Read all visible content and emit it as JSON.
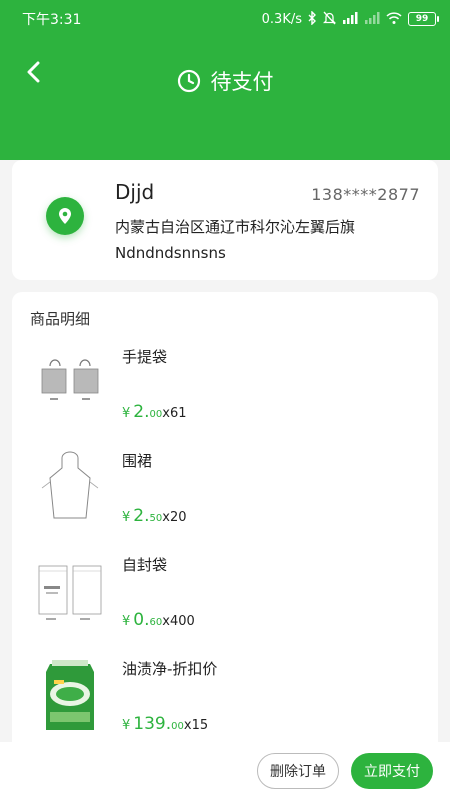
{
  "status_bar": {
    "time": "下午3:31",
    "speed": "0.3K/s",
    "battery": "99"
  },
  "header": {
    "title": "待支付"
  },
  "address": {
    "name": "Djjd",
    "phone": "138****2877",
    "line1": "内蒙古自治区通辽市科尔沁左翼后旗",
    "line2": "Ndndndsnnsns"
  },
  "goods": {
    "section_title": "商品明细",
    "items": [
      {
        "name": "手提袋",
        "currency": "¥",
        "price_int": "2.",
        "price_dec": "00",
        "qty": "x61"
      },
      {
        "name": "围裙",
        "currency": "¥",
        "price_int": "2.",
        "price_dec": "50",
        "qty": "x20"
      },
      {
        "name": "自封袋",
        "currency": "¥",
        "price_int": "0.",
        "price_dec": "60",
        "qty": "x400"
      },
      {
        "name": "油渍净-折扣价",
        "currency": "¥",
        "price_int": "139.",
        "price_dec": "00",
        "qty": "x15"
      }
    ]
  },
  "actions": {
    "delete_label": "删除订单",
    "pay_label": "立即支付"
  },
  "colors": {
    "brand_green": "#2db33e"
  }
}
